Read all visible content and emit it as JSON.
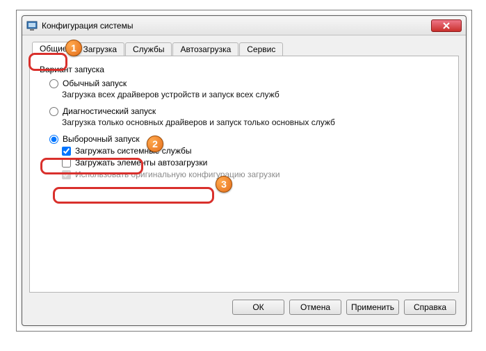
{
  "window": {
    "title": "Конфигурация системы"
  },
  "tabs": {
    "general": "Общие",
    "boot": "Загрузка",
    "services": "Службы",
    "startup": "Автозагрузка",
    "tools": "Сервис"
  },
  "group": {
    "label": "Вариант запуска"
  },
  "options": {
    "normal": {
      "label": "Обычный запуск",
      "desc": "Загрузка всех драйверов устройств и запуск всех служб"
    },
    "diagnostic": {
      "label": "Диагностический запуск",
      "desc": "Загрузка только основных драйверов и запуск только основных служб"
    },
    "selective": {
      "label": "Выборочный запуск"
    }
  },
  "checks": {
    "system_services": "Загружать системные службы",
    "startup_items": "Загружать элементы автозагрузки",
    "original_boot": "Использовать оригинальную конфигурацию загрузки"
  },
  "buttons": {
    "ok": "ОК",
    "cancel": "Отмена",
    "apply": "Применить",
    "help": "Справка"
  },
  "markers": {
    "m1": "1",
    "m2": "2",
    "m3": "3"
  }
}
